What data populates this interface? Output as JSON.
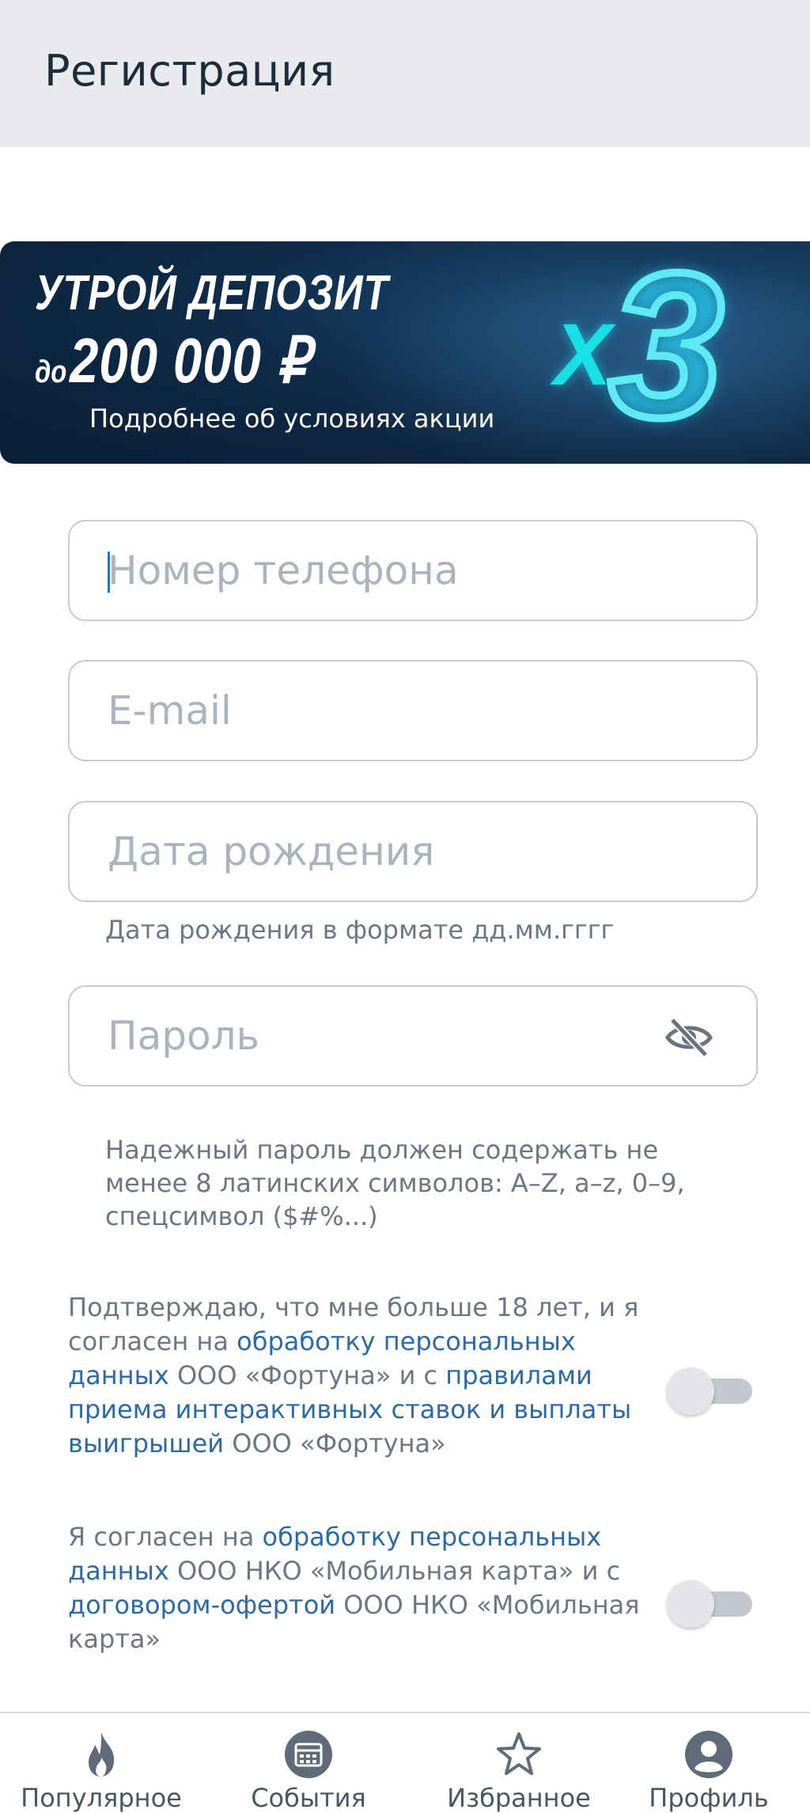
{
  "header": {
    "title": "Регистрация"
  },
  "banner": {
    "line1": "УТРОЙ ДЕПОЗИТ",
    "prefix": "до",
    "amount": "200 000 ₽",
    "subtitle": "Подробнее об условиях акции",
    "multiplier_x": "X",
    "multiplier_value": "3"
  },
  "form": {
    "phone_placeholder": "Номер телефона",
    "email_placeholder": "E-mail",
    "birthdate_placeholder": "Дата рождения",
    "birthdate_helper": "Дата рождения в формате дд.мм.гггг",
    "password_placeholder": "Пароль",
    "password_helper_1": "Надежный пароль должен содержать не",
    "password_helper_2": "менее 8 латинских символов: A–Z, a–z, 0–9,",
    "password_helper_3": "спецсимвол ($#%...)"
  },
  "consent1": {
    "t1": "Подтверждаю, что мне больше 18 лет, и я согласен на ",
    "l1": "обработку персональных данных",
    "t2": " ООО «Фортуна» и с ",
    "l2": "правилами приема интерактивных ставок и выплаты выигрышей",
    "t3": " ООО «Фортуна»",
    "checked": false
  },
  "consent2": {
    "t1": "Я согласен на ",
    "l1": "обработку персональных данных",
    "t2": " ООО НКО «Мобильная карта» и с ",
    "l2": "договором-офертой",
    "t3": " ООО НКО «Мобильная карта»",
    "checked": false
  },
  "nav": {
    "popular": "Популярное",
    "events": "События",
    "favorites": "Избранное",
    "profile": "Профиль"
  },
  "icons": {
    "popular": "flame-icon",
    "events": "calendar-icon",
    "favorites": "star-icon",
    "profile": "user-icon",
    "password_toggle": "eye-off-icon"
  },
  "colors": {
    "header_bg": "#e8eaed",
    "link": "#2b6aa8",
    "banner_accent": "#19e0e6"
  }
}
